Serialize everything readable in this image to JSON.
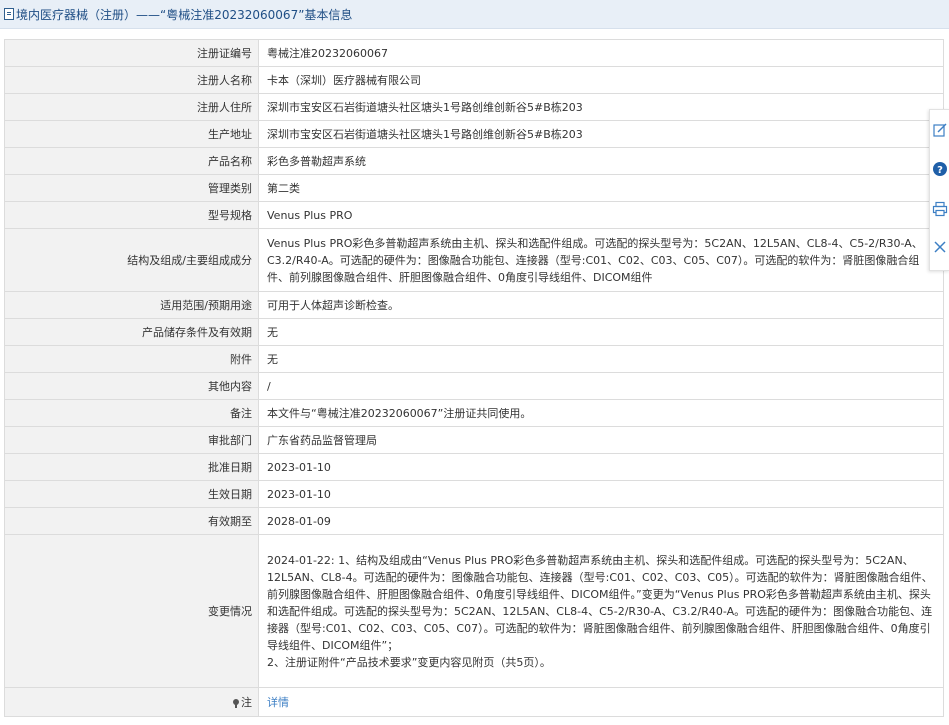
{
  "header": {
    "title": "境内医疗器械（注册）——“粤械注准20232060067”基本信息"
  },
  "rows": [
    {
      "label": "注册证编号",
      "value": "粤械注准20232060067"
    },
    {
      "label": "注册人名称",
      "value": "卡本（深圳）医疗器械有限公司"
    },
    {
      "label": "注册人住所",
      "value": "深圳市宝安区石岩街道塘头社区塘头1号路创维创新谷5#B栋203"
    },
    {
      "label": "生产地址",
      "value": "深圳市宝安区石岩街道塘头社区塘头1号路创维创新谷5#B栋203"
    },
    {
      "label": "产品名称",
      "value": "彩色多普勒超声系统"
    },
    {
      "label": "管理类别",
      "value": "第二类"
    },
    {
      "label": "型号规格",
      "value": "Venus Plus PRO"
    },
    {
      "label": "结构及组成/主要组成成分",
      "value": "Venus Plus PRO彩色多普勒超声系统由主机、探头和选配件组成。可选配的探头型号为：5C2AN、12L5AN、CL8-4、C5-2/R30-A、C3.2/R40-A。可选配的硬件为：图像融合功能包、连接器（型号:C01、C02、C03、C05、C07）。可选配的软件为：肾脏图像融合组件、前列腺图像融合组件、肝胆图像融合组件、0角度引导线组件、DICOM组件"
    },
    {
      "label": "适用范围/预期用途",
      "value": "可用于人体超声诊断检查。"
    },
    {
      "label": "产品储存条件及有效期",
      "value": "无"
    },
    {
      "label": "附件",
      "value": "无"
    },
    {
      "label": "其他内容",
      "value": "/"
    },
    {
      "label": "备注",
      "value": "本文件与“粤械注准20232060067”注册证共同使用。"
    },
    {
      "label": "审批部门",
      "value": "广东省药品监督管理局"
    },
    {
      "label": "批准日期",
      "value": "2023-01-10"
    },
    {
      "label": "生效日期",
      "value": "2023-01-10"
    },
    {
      "label": "有效期至",
      "value": "2028-01-09"
    }
  ],
  "change": {
    "label": "变更情况",
    "para1": "2024-01-22: 1、结构及组成由“Venus Plus PRO彩色多普勒超声系统由主机、探头和选配件组成。可选配的探头型号为：5C2AN、12L5AN、CL8-4。可选配的硬件为：图像融合功能包、连接器（型号:C01、C02、C03、C05）。可选配的软件为：肾脏图像融合组件、前列腺图像融合组件、肝胆图像融合组件、0角度引导线组件、DICOM组件。”变更为“Venus Plus PRO彩色多普勒超声系统由主机、探头和选配件组成。可选配的探头型号为：5C2AN、12L5AN、CL8-4、C5-2/R30-A、C3.2/R40-A。可选配的硬件为：图像融合功能包、连接器（型号:C01、C02、C03、C05、C07）。可选配的软件为：肾脏图像融合组件、前列腺图像融合组件、肝胆图像融合组件、0角度引导线组件、DICOM组件”；",
    "para2": "2、注册证附件“产品技术要求”变更内容见附页（共5页）。"
  },
  "note": {
    "label": "注",
    "link": "详情"
  },
  "side_tools": [
    "edit-icon",
    "help-icon",
    "print-icon",
    "close-icon"
  ],
  "colors": {
    "header_bg": "#e8eff7",
    "header_text": "#1f4e85",
    "label_bg": "#f2f2f2",
    "link": "#3d7fc4"
  }
}
